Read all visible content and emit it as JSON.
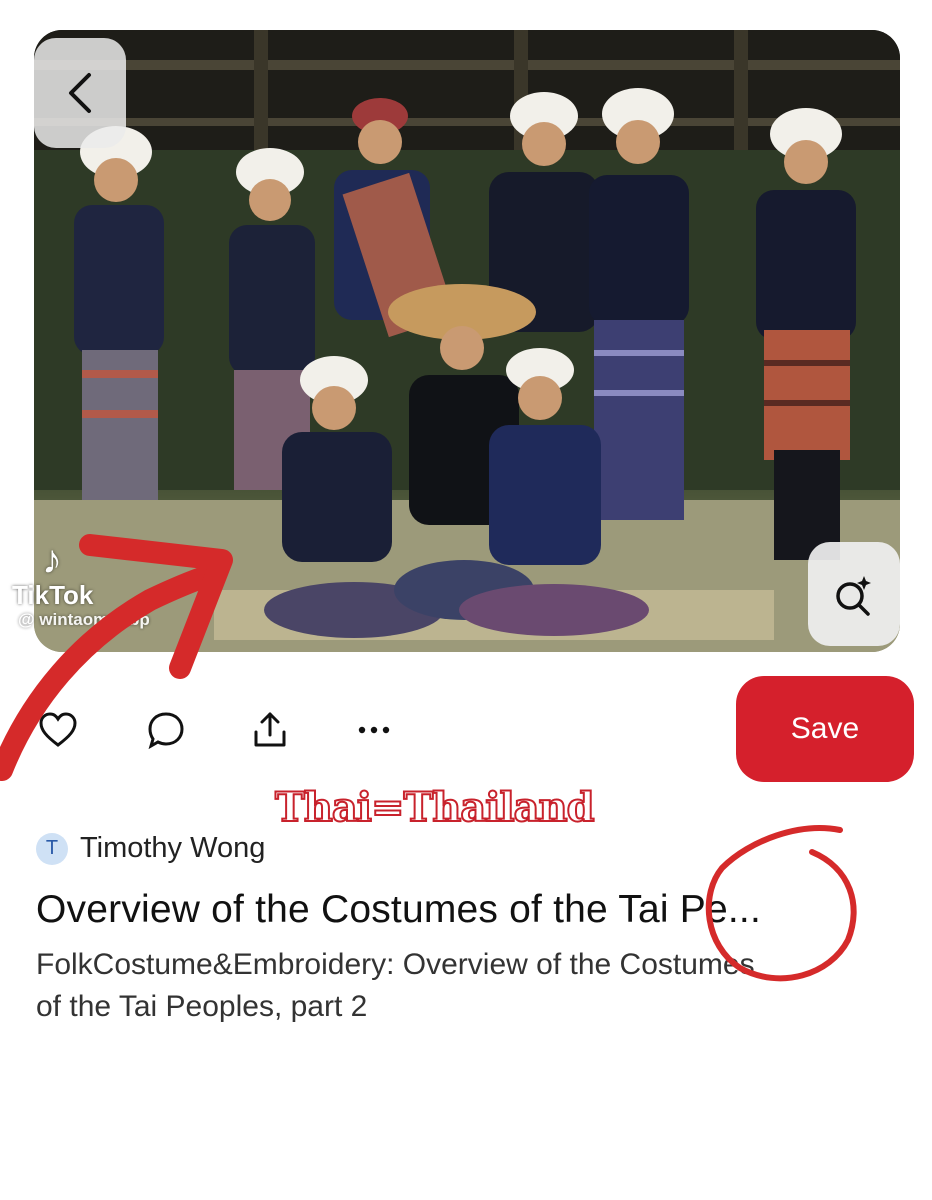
{
  "watermark": {
    "brand": "TikTok",
    "handle": "@ wintaomunbp"
  },
  "pin": {
    "save_label": "Save",
    "overlay_caption": "Thai=Thailand",
    "author": {
      "initial": "T",
      "name": "Timothy Wong"
    },
    "title": "Overview of the Costumes of the Tai Pe...",
    "description": "FolkCostume&Embroidery: Overview of the Costumes of the Tai Peoples, part 2"
  },
  "icons": {
    "back": "chevron-left-icon",
    "visual_search": "lens-search-icon",
    "like": "heart-icon",
    "comment": "comment-icon",
    "share": "share-icon",
    "more": "more-icon"
  },
  "colors": {
    "accent": "#d5202c",
    "annotation": "#d52a2a"
  }
}
